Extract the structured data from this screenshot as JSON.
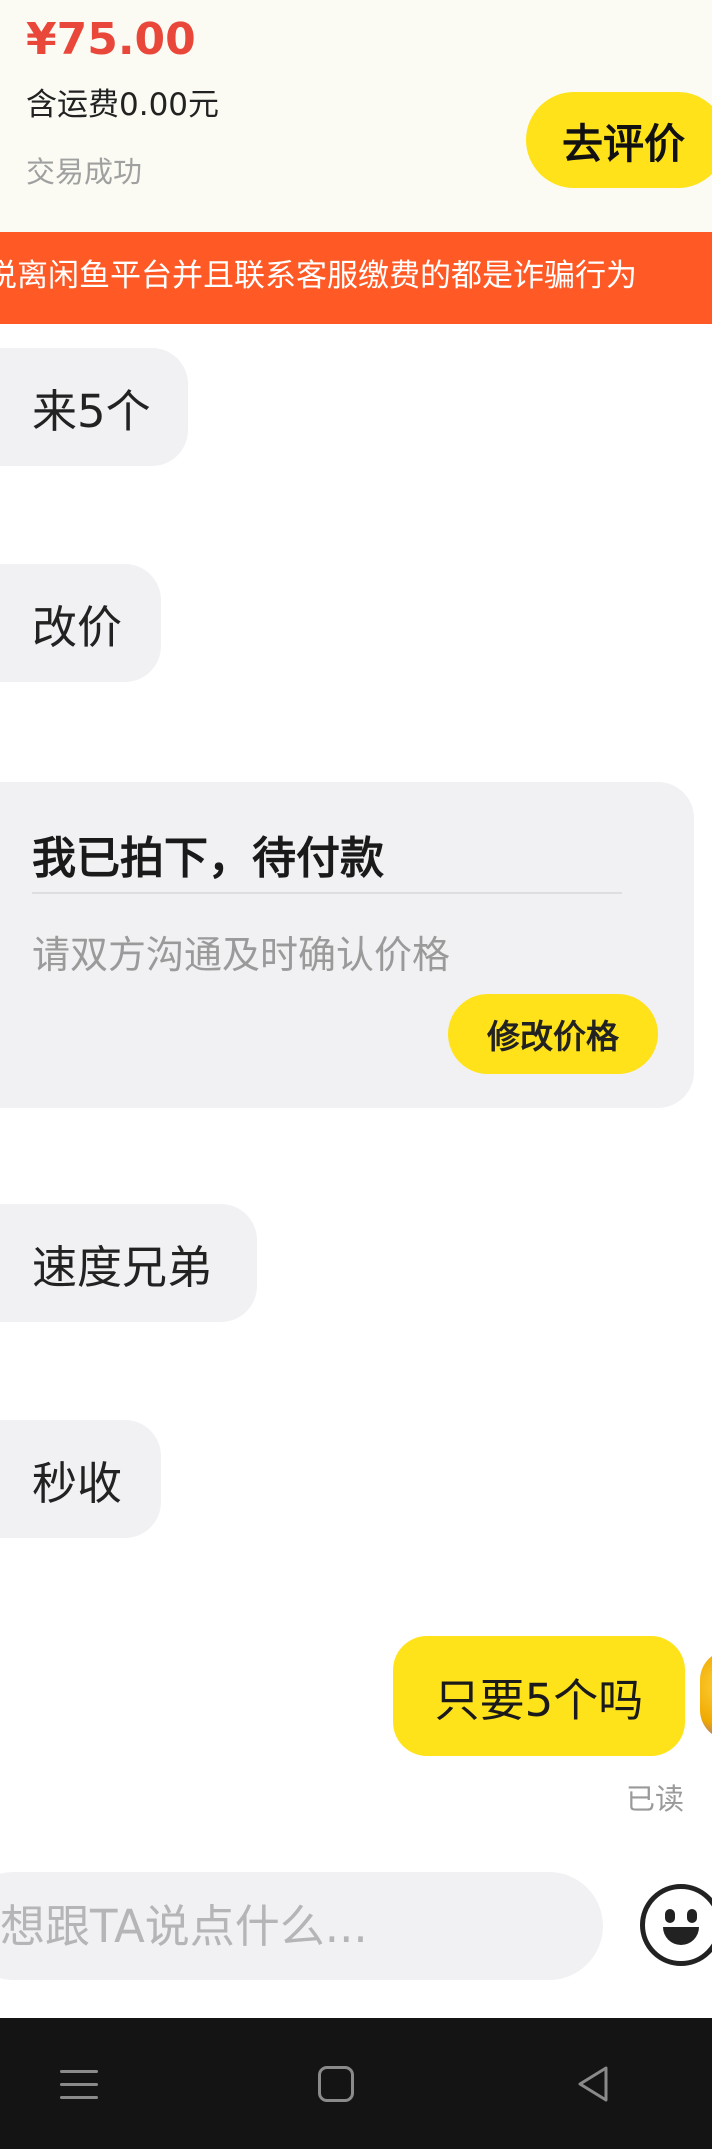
{
  "order": {
    "price": "¥75.00",
    "shipping": "含运费0.00元",
    "status": "交易成功",
    "review_button": "去评价"
  },
  "warning_banner": {
    "text": "说离闲鱼平台并且联系客服缴费的都是诈骗行为"
  },
  "messages": {
    "m1": "来5个",
    "m2": "改价",
    "offer_card": {
      "title": "我已拍下，待付款",
      "note": "请双方沟通及时确认价格",
      "button": "修改价格"
    },
    "m3": "速度兄弟",
    "m4": "秒收",
    "my_message": "只要5个吗",
    "read_status": "已读"
  },
  "input_bar": {
    "placeholder": "想跟TA说点什么..."
  },
  "icons": {
    "emoji": "smiley-icon",
    "nav_menu": "menu-icon",
    "nav_home": "home-icon",
    "nav_back": "back-icon"
  },
  "colors": {
    "accent_yellow": "#ffe21a",
    "price_red": "#e8473a",
    "warning_orange": "#ff5a26"
  }
}
